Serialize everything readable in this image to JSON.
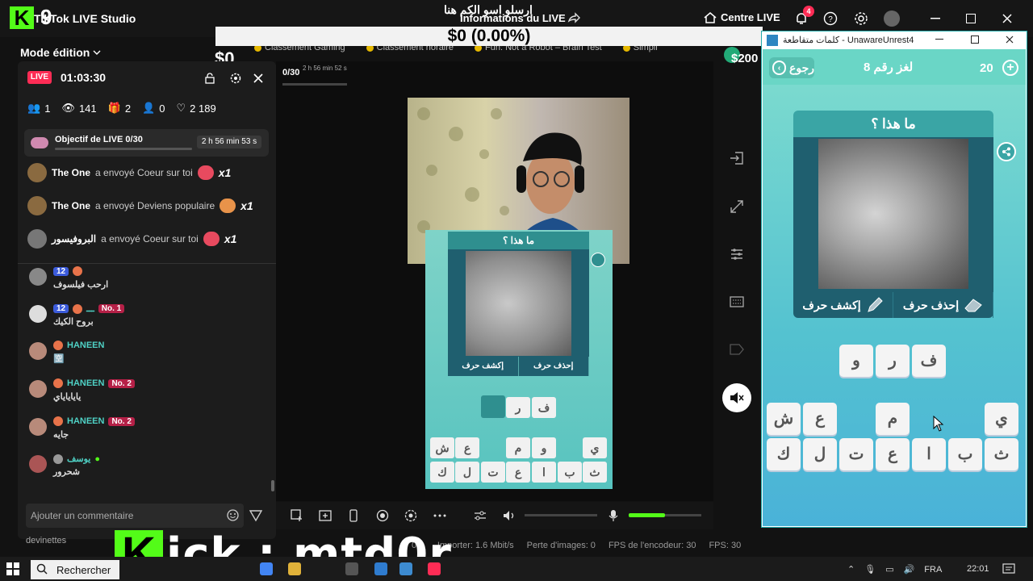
{
  "app": {
    "title": "TikTok LIVE Studio",
    "badge_number": "9",
    "kick_letter": "K",
    "live_info": "Informations du LIVE",
    "live_info_arabic": "ارسلو اسو الكم هنا",
    "centre_live": "Centre LIVE",
    "notification_count": "4"
  },
  "earnings": {
    "bar": "$0 (0.00%)",
    "overlay": "$0",
    "right": "$200"
  },
  "mode": {
    "label": "Mode édition"
  },
  "pills": [
    "Classement Gaming",
    "Classement horaire",
    "Fun: Not a Robot – Brain Test",
    "Simpli"
  ],
  "live_panel": {
    "badge": "LIVE",
    "timer": "01:03:30",
    "stats": {
      "viewers_now": "1",
      "views": "141",
      "gifts": "2",
      "followers": "0",
      "likes": "2 189"
    },
    "objective": {
      "label": "Objectif de LIVE 0/30",
      "progress": 0.0,
      "time": "2 h 56 min 53 s"
    },
    "gifts": [
      {
        "name": "The One",
        "text": "a envoyé Coeur sur toi",
        "mult": "x1"
      },
      {
        "name": "The One",
        "text": "a envoyé Deviens populaire",
        "mult": "x1"
      },
      {
        "name": "البروفيسور",
        "text": "a envoyé Coeur sur toi",
        "mult": "x1"
      }
    ],
    "chat": [
      {
        "name": "",
        "level": "12",
        "text": "ارحب فيلسوف",
        "no": ""
      },
      {
        "name": "ـــ",
        "level": "12",
        "text": "بروح الكيك",
        "no": "No. 1"
      },
      {
        "name": "HANEEN",
        "level": "",
        "text": "🈳",
        "no": ""
      },
      {
        "name": "HANEEN",
        "level": "",
        "text": "ياياياياي",
        "no": "No. 2"
      },
      {
        "name": "HANEEN",
        "level": "",
        "text": "جايه",
        "no": "No. 2"
      },
      {
        "name": "يوسف",
        "level": "",
        "text": "شحرور",
        "no": ""
      }
    ],
    "comment_placeholder": "Ajouter un commentaire",
    "devinettes": "devinettes"
  },
  "stage": {
    "progress_label": "0/30",
    "time": "2 h 56 min 52 s",
    "mini_game": {
      "title": "ما هذا ؟",
      "btn_reveal": "إكشف حرف",
      "btn_delete": "إحذف حرف",
      "answer_tiles": [
        "ر",
        "ف"
      ],
      "row1": [
        "ي",
        "",
        "و",
        "م",
        "",
        "ع",
        "ش"
      ],
      "row2": [
        "ث",
        "ب",
        "ا",
        "ع",
        "ت",
        "ل",
        "ك"
      ]
    }
  },
  "status": {
    "percent": "0%",
    "importer": "Importer: 1.6 Mbit/s",
    "dropped": "Perte d'images: 0",
    "encoder_fps": "FPS de l'encodeur: 30",
    "fps": "FPS: 30"
  },
  "watermark": {
    "k": "K",
    "handle": "ick : mtd0r"
  },
  "game_window": {
    "title": "كلمات متقاطعة - UnawareUnrest4",
    "back": "رجوع",
    "level": "لغز رقم 8",
    "coins": "20",
    "question": "ما هذا ؟",
    "btn_reveal": "إكشف حرف",
    "btn_delete": "إحذف حرف",
    "answer_tiles": [
      "ف",
      "ر",
      "و"
    ],
    "row1": [
      "ي",
      "م",
      "ع",
      "ش"
    ],
    "row2": [
      "ث",
      "ب",
      "ا",
      "ع",
      "ت",
      "ل",
      "ك"
    ]
  },
  "taskbar": {
    "search": "Rechercher",
    "lang": "FRA",
    "time": "22:01"
  },
  "colors": {
    "kick_green": "#53fc18",
    "tiktok_red": "#fe2c55",
    "game_teal": "#3aa5a5"
  }
}
